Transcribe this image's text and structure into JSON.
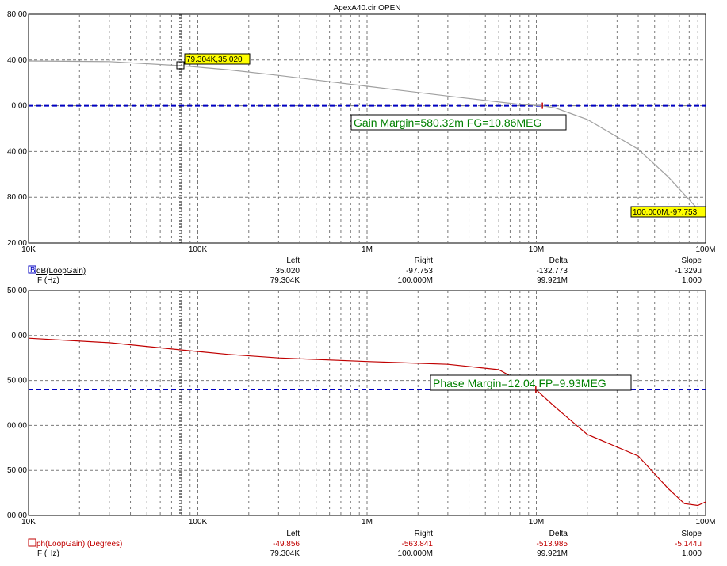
{
  "chart_data": [
    {
      "type": "line",
      "title": "ApexA40.cir OPEN",
      "x_axis": {
        "scale": "log",
        "min": 10000,
        "max": 100000000,
        "tick_labels": [
          "10K",
          "100K",
          "1M",
          "10M",
          "100M"
        ]
      },
      "y_axis": {
        "min": -120,
        "max": 80,
        "tick_labels": [
          "80.00",
          "40.00",
          "0.00",
          "40.00",
          "80.00",
          "20.00"
        ]
      },
      "grid": true,
      "series": [
        {
          "name": "dB(LoopGain)",
          "color": "#a0a0a0",
          "x": [
            10000,
            30000,
            79304,
            150000,
            300000,
            1000000,
            3000000,
            8000000,
            10860000,
            13000000,
            20000000,
            40000000,
            60000000,
            100000000
          ],
          "y": [
            39.2,
            38.6,
            35.02,
            31.5,
            26.5,
            17.0,
            8.5,
            1.2,
            0.0,
            -2.0,
            -12.0,
            -38.0,
            -62.0,
            -97.753
          ]
        }
      ],
      "reference_line": {
        "y": 0,
        "color": "#0000c0",
        "style": "dashed"
      },
      "cursors": [
        {
          "label": "79.304K,35.020",
          "x": 79304,
          "y": 35.02
        },
        {
          "label": "100.000M,-97.753",
          "x": 100000000,
          "y": -97.753
        }
      ],
      "annotation": "Gain Margin=580.32m FG=10.86MEG",
      "readout": {
        "columns": [
          "Left",
          "Right",
          "Delta",
          "Slope"
        ],
        "rows": [
          {
            "name": "dB(LoopGain)",
            "prefix": "B",
            "values": [
              "35.020",
              "-97.753",
              "-132.773",
              "-1.329u"
            ]
          },
          {
            "name": "F (Hz)",
            "values": [
              "79.304K",
              "100.000M",
              "99.921M",
              "1.000"
            ]
          }
        ]
      }
    },
    {
      "type": "line",
      "title": "",
      "x_axis": {
        "scale": "log",
        "min": 10000,
        "max": 100000000,
        "tick_labels": [
          "10K",
          "100K",
          "1M",
          "10M",
          "100M"
        ]
      },
      "y_axis": {
        "min": -200,
        "max": 50,
        "tick_labels": [
          "50.00",
          "0.00",
          "50.00",
          "00.00",
          "50.00",
          "00.00"
        ]
      },
      "grid": true,
      "series": [
        {
          "name": "ph(LoopGain) (Degrees)",
          "color": "#c00000",
          "x": [
            10000,
            30000,
            79304,
            150000,
            300000,
            1000000,
            3000000,
            6000000,
            9930000,
            13000000,
            20000000,
            40000000,
            60000000,
            75000000,
            90000000,
            100000000
          ],
          "y": [
            -3.0,
            -8.0,
            -16.0,
            -21.0,
            -25.0,
            -29.0,
            -32.0,
            -38.0,
            -60.0,
            -80.0,
            -110.0,
            -134.0,
            -170.0,
            -187.0,
            -189.0,
            -185.0
          ]
        }
      ],
      "reference_line": {
        "y": -60,
        "color": "#0000c0",
        "style": "dashed"
      },
      "annotation": "Phase Margin=12.04 FP=9.93MEG",
      "readout": {
        "columns": [
          "Left",
          "Right",
          "Delta",
          "Slope"
        ],
        "rows": [
          {
            "name": "ph(LoopGain) (Degrees)",
            "values": [
              "-49.856",
              "-563.841",
              "-513.985",
              "-5.144u"
            ]
          },
          {
            "name": "F (Hz)",
            "values": [
              "79.304K",
              "100.000M",
              "99.921M",
              "1.000"
            ]
          }
        ]
      }
    }
  ]
}
